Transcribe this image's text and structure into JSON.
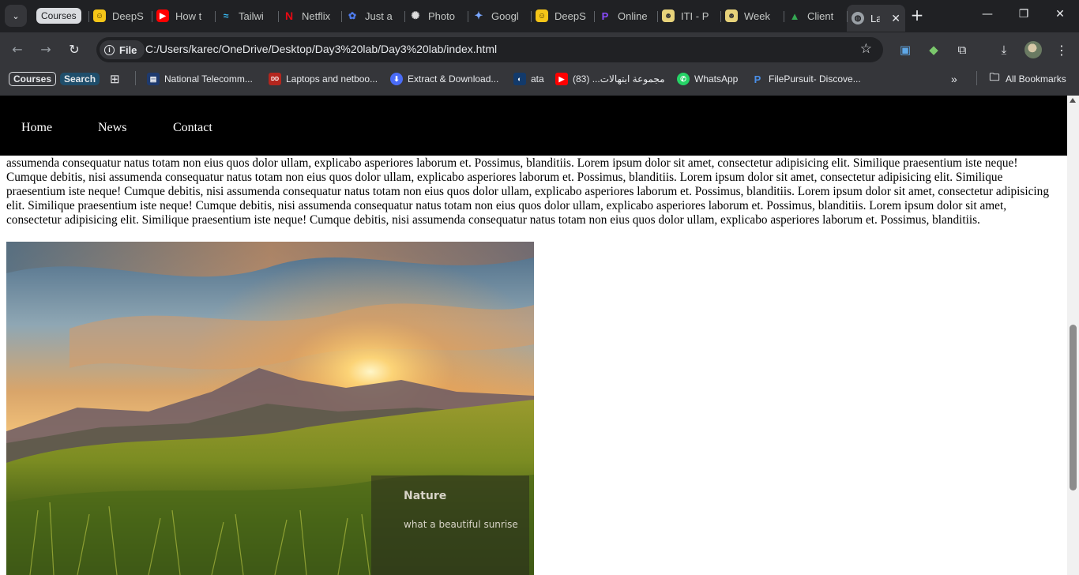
{
  "browser": {
    "tabs": [
      {
        "label": "Courses",
        "type": "group"
      },
      {
        "label": "DeepS",
        "icon": "smiley-face-icon",
        "color": "#f5c518"
      },
      {
        "label": "How t",
        "icon": "youtube-icon",
        "color": "#ff0000"
      },
      {
        "label": "Tailwi",
        "icon": "tailwind-icon",
        "color": "#38bdf8"
      },
      {
        "label": "Netflix",
        "icon": "netflix-icon",
        "color": "#e50914"
      },
      {
        "label": "Just a",
        "icon": "cloudflare-icon",
        "color": "#4f7df0"
      },
      {
        "label": "Photo",
        "icon": "openai-icon",
        "color": "#dddddd"
      },
      {
        "label": "Googl",
        "icon": "gemini-icon",
        "color": "#7aa7ff"
      },
      {
        "label": "DeepS",
        "icon": "smiley-face-icon",
        "color": "#f5c518"
      },
      {
        "label": "Online",
        "icon": "purple-p-icon",
        "color": "#8a4bff"
      },
      {
        "label": "ITI - P",
        "icon": "emoji-icon",
        "color": "#e7d27a"
      },
      {
        "label": "Week",
        "icon": "emoji-icon",
        "color": "#e7d27a"
      },
      {
        "label": "Client",
        "icon": "google-drive-icon",
        "color": "#34a853"
      },
      {
        "label": "La",
        "icon": "globe-icon",
        "color": "#9aa0a6",
        "active": true
      }
    ],
    "url_scheme": "File",
    "url": "C:/Users/karec/OneDrive/Desktop/Day3%20lab/Day3%20lab/index.html",
    "bookmarks": [
      {
        "label": "Courses"
      },
      {
        "label": "Search"
      },
      {
        "label": "National Telecomm..."
      },
      {
        "label": "Laptops and netboo..."
      },
      {
        "label": "Extract & Download..."
      },
      {
        "label": "ata"
      },
      {
        "label": "مجموعة ابتهالات... (83)"
      },
      {
        "label": "WhatsApp"
      },
      {
        "label": "FilePursuit- Discove..."
      },
      {
        "label": "All Bookmarks"
      }
    ]
  },
  "page": {
    "nav": [
      "Home",
      "News",
      "Contact"
    ],
    "paragraph": "assumenda consequatur natus totam non eius quos dolor ullam, explicabo asperiores laborum et. Possimus, blanditiis. Lorem ipsum dolor sit amet, consectetur adipisicing elit. Similique praesentium iste neque! Cumque debitis, nisi assumenda consequatur natus totam non eius quos dolor ullam, explicabo asperiores laborum et. Possimus, blanditiis. Lorem ipsum dolor sit amet, consectetur adipisicing elit. Similique praesentium iste neque! Cumque debitis, nisi assumenda consequatur natus totam non eius quos dolor ullam, explicabo asperiores laborum et. Possimus, blanditiis. Lorem ipsum dolor sit amet, consectetur adipisicing elit. Similique praesentium iste neque! Cumque debitis, nisi assumenda consequatur natus totam non eius quos dolor ullam, explicabo asperiores laborum et. Possimus, blanditiis. Lorem ipsum dolor sit amet, consectetur adipisicing elit. Similique praesentium iste neque! Cumque debitis, nisi assumenda consequatur natus totam non eius quos dolor ullam, explicabo asperiores laborum et. Possimus, blanditiis.",
    "caption_title": "Nature",
    "caption_subtitle": "what a beautiful sunrise"
  }
}
